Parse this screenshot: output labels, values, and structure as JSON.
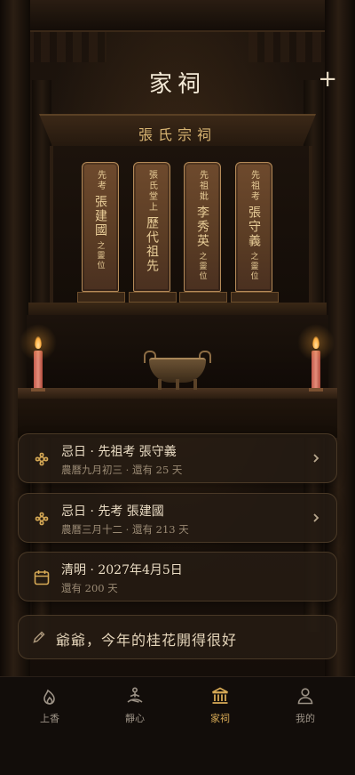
{
  "header": {
    "title": "家祠",
    "add_icon": "plus-icon"
  },
  "shrine": {
    "plaque": "張氏宗祠",
    "tablets": [
      {
        "top": "先考",
        "name": "張建國",
        "tail": "之靈位"
      },
      {
        "top": "張氏堂上",
        "name": "歷代祖先",
        "tail": ""
      },
      {
        "top": "先祖妣",
        "name": "李秀英",
        "tail": "之靈位"
      },
      {
        "top": "先祖考",
        "name": "張守義",
        "tail": "之靈位"
      }
    ]
  },
  "cards": [
    {
      "icon": "flower-icon",
      "title": "忌日 · 先祖考 張守義",
      "sub": "農曆九月初三 · 還有 25 天"
    },
    {
      "icon": "flower-icon",
      "title": "忌日 · 先考 張建國",
      "sub": "農曆三月十二 · 還有 213 天"
    },
    {
      "icon": "calendar-icon",
      "title": "清明 · 2027年4月5日",
      "sub": "還有 200 天"
    }
  ],
  "memo": {
    "icon": "pencil-icon",
    "text": "爺爺，今年的桂花開得很好"
  },
  "nav": {
    "items": [
      {
        "label": "上香",
        "icon": "incense-flame-icon"
      },
      {
        "label": "靜心",
        "icon": "meditation-icon"
      },
      {
        "label": "家祠",
        "icon": "temple-icon"
      },
      {
        "label": "我的",
        "icon": "person-icon"
      }
    ],
    "active_index": 2
  },
  "colors": {
    "accent": "#d6a955",
    "background": "#120c08",
    "candle": "#d9705f"
  }
}
